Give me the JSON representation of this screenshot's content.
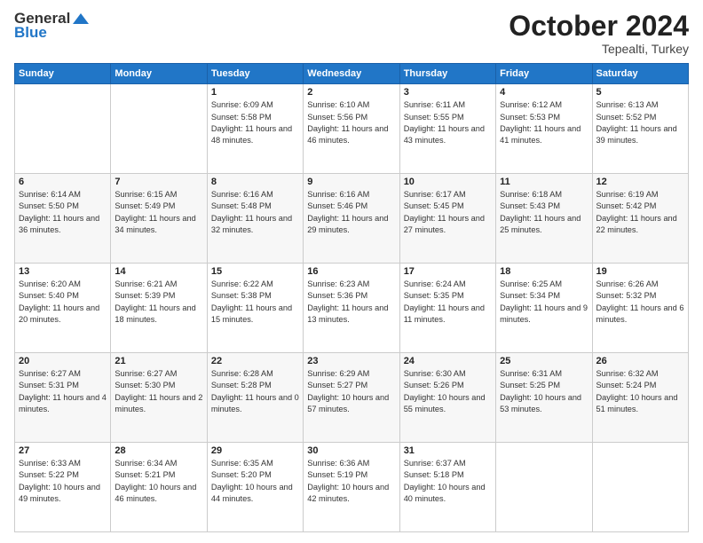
{
  "header": {
    "logo_general": "General",
    "logo_blue": "Blue",
    "month": "October 2024",
    "location": "Tepealti, Turkey"
  },
  "days_of_week": [
    "Sunday",
    "Monday",
    "Tuesday",
    "Wednesday",
    "Thursday",
    "Friday",
    "Saturday"
  ],
  "weeks": [
    [
      {
        "day": "",
        "info": ""
      },
      {
        "day": "",
        "info": ""
      },
      {
        "day": "1",
        "sunrise": "Sunrise: 6:09 AM",
        "sunset": "Sunset: 5:58 PM",
        "daylight": "Daylight: 11 hours and 48 minutes."
      },
      {
        "day": "2",
        "sunrise": "Sunrise: 6:10 AM",
        "sunset": "Sunset: 5:56 PM",
        "daylight": "Daylight: 11 hours and 46 minutes."
      },
      {
        "day": "3",
        "sunrise": "Sunrise: 6:11 AM",
        "sunset": "Sunset: 5:55 PM",
        "daylight": "Daylight: 11 hours and 43 minutes."
      },
      {
        "day": "4",
        "sunrise": "Sunrise: 6:12 AM",
        "sunset": "Sunset: 5:53 PM",
        "daylight": "Daylight: 11 hours and 41 minutes."
      },
      {
        "day": "5",
        "sunrise": "Sunrise: 6:13 AM",
        "sunset": "Sunset: 5:52 PM",
        "daylight": "Daylight: 11 hours and 39 minutes."
      }
    ],
    [
      {
        "day": "6",
        "sunrise": "Sunrise: 6:14 AM",
        "sunset": "Sunset: 5:50 PM",
        "daylight": "Daylight: 11 hours and 36 minutes."
      },
      {
        "day": "7",
        "sunrise": "Sunrise: 6:15 AM",
        "sunset": "Sunset: 5:49 PM",
        "daylight": "Daylight: 11 hours and 34 minutes."
      },
      {
        "day": "8",
        "sunrise": "Sunrise: 6:16 AM",
        "sunset": "Sunset: 5:48 PM",
        "daylight": "Daylight: 11 hours and 32 minutes."
      },
      {
        "day": "9",
        "sunrise": "Sunrise: 6:16 AM",
        "sunset": "Sunset: 5:46 PM",
        "daylight": "Daylight: 11 hours and 29 minutes."
      },
      {
        "day": "10",
        "sunrise": "Sunrise: 6:17 AM",
        "sunset": "Sunset: 5:45 PM",
        "daylight": "Daylight: 11 hours and 27 minutes."
      },
      {
        "day": "11",
        "sunrise": "Sunrise: 6:18 AM",
        "sunset": "Sunset: 5:43 PM",
        "daylight": "Daylight: 11 hours and 25 minutes."
      },
      {
        "day": "12",
        "sunrise": "Sunrise: 6:19 AM",
        "sunset": "Sunset: 5:42 PM",
        "daylight": "Daylight: 11 hours and 22 minutes."
      }
    ],
    [
      {
        "day": "13",
        "sunrise": "Sunrise: 6:20 AM",
        "sunset": "Sunset: 5:40 PM",
        "daylight": "Daylight: 11 hours and 20 minutes."
      },
      {
        "day": "14",
        "sunrise": "Sunrise: 6:21 AM",
        "sunset": "Sunset: 5:39 PM",
        "daylight": "Daylight: 11 hours and 18 minutes."
      },
      {
        "day": "15",
        "sunrise": "Sunrise: 6:22 AM",
        "sunset": "Sunset: 5:38 PM",
        "daylight": "Daylight: 11 hours and 15 minutes."
      },
      {
        "day": "16",
        "sunrise": "Sunrise: 6:23 AM",
        "sunset": "Sunset: 5:36 PM",
        "daylight": "Daylight: 11 hours and 13 minutes."
      },
      {
        "day": "17",
        "sunrise": "Sunrise: 6:24 AM",
        "sunset": "Sunset: 5:35 PM",
        "daylight": "Daylight: 11 hours and 11 minutes."
      },
      {
        "day": "18",
        "sunrise": "Sunrise: 6:25 AM",
        "sunset": "Sunset: 5:34 PM",
        "daylight": "Daylight: 11 hours and 9 minutes."
      },
      {
        "day": "19",
        "sunrise": "Sunrise: 6:26 AM",
        "sunset": "Sunset: 5:32 PM",
        "daylight": "Daylight: 11 hours and 6 minutes."
      }
    ],
    [
      {
        "day": "20",
        "sunrise": "Sunrise: 6:27 AM",
        "sunset": "Sunset: 5:31 PM",
        "daylight": "Daylight: 11 hours and 4 minutes."
      },
      {
        "day": "21",
        "sunrise": "Sunrise: 6:27 AM",
        "sunset": "Sunset: 5:30 PM",
        "daylight": "Daylight: 11 hours and 2 minutes."
      },
      {
        "day": "22",
        "sunrise": "Sunrise: 6:28 AM",
        "sunset": "Sunset: 5:28 PM",
        "daylight": "Daylight: 11 hours and 0 minutes."
      },
      {
        "day": "23",
        "sunrise": "Sunrise: 6:29 AM",
        "sunset": "Sunset: 5:27 PM",
        "daylight": "Daylight: 10 hours and 57 minutes."
      },
      {
        "day": "24",
        "sunrise": "Sunrise: 6:30 AM",
        "sunset": "Sunset: 5:26 PM",
        "daylight": "Daylight: 10 hours and 55 minutes."
      },
      {
        "day": "25",
        "sunrise": "Sunrise: 6:31 AM",
        "sunset": "Sunset: 5:25 PM",
        "daylight": "Daylight: 10 hours and 53 minutes."
      },
      {
        "day": "26",
        "sunrise": "Sunrise: 6:32 AM",
        "sunset": "Sunset: 5:24 PM",
        "daylight": "Daylight: 10 hours and 51 minutes."
      }
    ],
    [
      {
        "day": "27",
        "sunrise": "Sunrise: 6:33 AM",
        "sunset": "Sunset: 5:22 PM",
        "daylight": "Daylight: 10 hours and 49 minutes."
      },
      {
        "day": "28",
        "sunrise": "Sunrise: 6:34 AM",
        "sunset": "Sunset: 5:21 PM",
        "daylight": "Daylight: 10 hours and 46 minutes."
      },
      {
        "day": "29",
        "sunrise": "Sunrise: 6:35 AM",
        "sunset": "Sunset: 5:20 PM",
        "daylight": "Daylight: 10 hours and 44 minutes."
      },
      {
        "day": "30",
        "sunrise": "Sunrise: 6:36 AM",
        "sunset": "Sunset: 5:19 PM",
        "daylight": "Daylight: 10 hours and 42 minutes."
      },
      {
        "day": "31",
        "sunrise": "Sunrise: 6:37 AM",
        "sunset": "Sunset: 5:18 PM",
        "daylight": "Daylight: 10 hours and 40 minutes."
      },
      {
        "day": "",
        "info": ""
      },
      {
        "day": "",
        "info": ""
      }
    ]
  ]
}
